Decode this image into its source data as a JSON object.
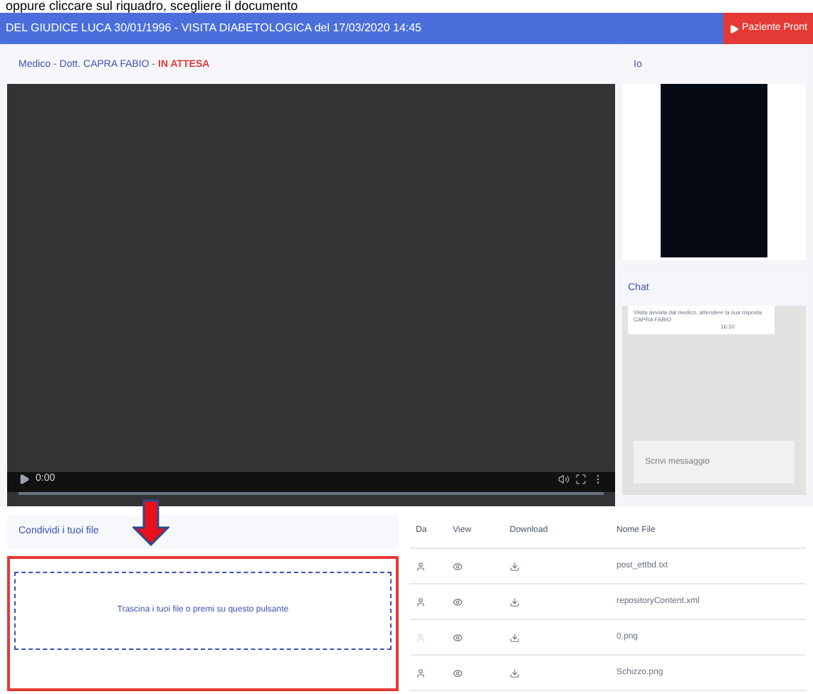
{
  "caption": "oppure cliccare sul riquadro, scegliere il documento",
  "header": {
    "title": "DEL GIUDICE LUCA 30/01/1996 - VISITA DIABETOLOGICA del 17/03/2020 14:45",
    "button": "Paziente Pront"
  },
  "main": {
    "doctor": "Medico - Dott. CAPRA FABIO - ",
    "status": "IN ATTESA",
    "time": "0:00"
  },
  "self_view": {
    "title": "Io"
  },
  "chat": {
    "title": "Chat",
    "messages": [
      {
        "text": "Visita avviata dal medico, attendere la sua risposta",
        "sender": "CAPRA FABIO",
        "time": "16:10"
      }
    ],
    "placeholder": "Scrivi messaggio"
  },
  "share": {
    "title": "Condividi i tuoi file",
    "dropzone": "Trascina i tuoi file o premi su questo pulsante"
  },
  "files": {
    "columns": [
      "Da",
      "View",
      "Download",
      "Nome File"
    ],
    "rows": [
      {
        "kind": "user",
        "name": "post_ettbd.txt"
      },
      {
        "kind": "user",
        "name": "repositoryContent.xml"
      },
      {
        "kind": "other",
        "name": "0.png"
      },
      {
        "kind": "user",
        "name": "Schizzo.png"
      }
    ]
  }
}
